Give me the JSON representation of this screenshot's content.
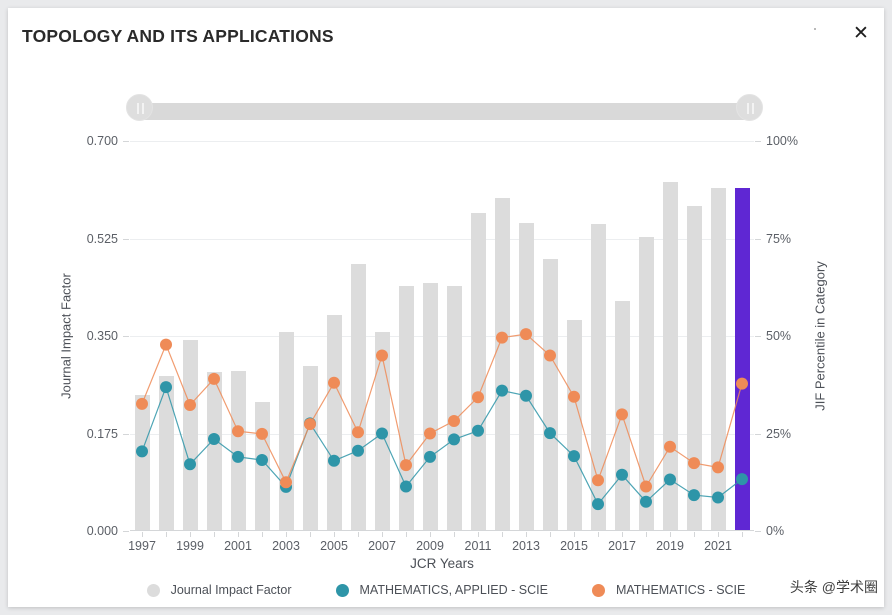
{
  "header": {
    "title": "TOPOLOGY AND ITS APPLICATIONS",
    "close_label": "✕"
  },
  "slider": {
    "name": "year-range-slider",
    "left_handle": "drag-handle-left",
    "right_handle": "drag-handle-right"
  },
  "legend": [
    {
      "label": "Journal Impact Factor",
      "color": "#dcdcdc",
      "icon": "circle-swatch"
    },
    {
      "label": "MATHEMATICS, APPLIED - SCIE",
      "color": "#2e95a8",
      "icon": "circle-swatch"
    },
    {
      "label": "MATHEMATICS - SCIE",
      "color": "#ef8b57",
      "icon": "circle-swatch"
    }
  ],
  "watermark": {
    "text": "头条 @学术圈"
  },
  "chart_data": {
    "type": "bar",
    "title": "TOPOLOGY AND ITS APPLICATIONS",
    "xlabel": "JCR Years",
    "ylabel": "Journal Impact Factor",
    "y2label": "JIF Percentile in Category",
    "ylim": [
      0.0,
      0.7
    ],
    "y2lim": [
      0,
      100
    ],
    "yticks": [
      "0.000",
      "0.175",
      "0.350",
      "0.525",
      "0.700"
    ],
    "ytickvals": [
      0.0,
      0.175,
      0.35,
      0.525,
      0.7
    ],
    "y2ticks": [
      "0%",
      "25%",
      "50%",
      "75%",
      "100%"
    ],
    "y2tickvals": [
      0,
      25,
      50,
      75,
      100
    ],
    "grid": true,
    "legend_position": "bottom",
    "categories": [
      "1997",
      "1998",
      "1999",
      "2000",
      "2001",
      "2002",
      "2003",
      "2004",
      "2005",
      "2006",
      "2007",
      "2008",
      "2009",
      "2010",
      "2011",
      "2012",
      "2013",
      "2014",
      "2015",
      "2016",
      "2017",
      "2018",
      "2019",
      "2020",
      "2021",
      "2022"
    ],
    "xticklabels": [
      "1997",
      "1999",
      "2001",
      "2003",
      "2005",
      "2007",
      "2009",
      "2011",
      "2013",
      "2015",
      "2017",
      "2019",
      "2021"
    ],
    "highlight_category": "2022",
    "highlight_color": "#5f27d3",
    "series": [
      {
        "name": "Journal Impact Factor",
        "type": "bar",
        "axis": "left",
        "color": "#dcdcdc",
        "values": [
          0.245,
          0.278,
          0.343,
          0.286,
          0.288,
          0.232,
          0.357,
          0.297,
          0.388,
          0.48,
          0.358,
          0.44,
          0.445,
          0.44,
          0.571,
          0.597,
          0.552,
          0.488,
          0.378,
          0.551,
          0.412,
          0.527,
          0.626,
          0.583,
          0.615
        ]
      },
      {
        "name": "MATHEMATICS, APPLIED - SCIE",
        "type": "line",
        "axis": "right",
        "color": "#2e95a8",
        "values": [
          20.4,
          36.9,
          17.1,
          23.6,
          19.0,
          18.2,
          11.3,
          27.6,
          18.0,
          20.6,
          25.0,
          11.4,
          19.0,
          23.5,
          25.7,
          36.0,
          34.7,
          25.1,
          19.2,
          6.9,
          14.4,
          7.5,
          13.2,
          9.2,
          8.6,
          13.3
        ]
      },
      {
        "name": "MATHEMATICS - SCIE",
        "type": "line",
        "axis": "right",
        "color": "#ef8b57",
        "values": [
          32.6,
          47.8,
          32.3,
          39.0,
          25.6,
          24.9,
          12.5,
          27.4,
          38.0,
          25.3,
          45.0,
          16.9,
          25.0,
          28.2,
          34.3,
          49.6,
          50.5,
          45.0,
          34.4,
          13.0,
          29.9,
          11.4,
          21.6,
          17.4,
          16.3,
          37.8
        ]
      }
    ]
  }
}
